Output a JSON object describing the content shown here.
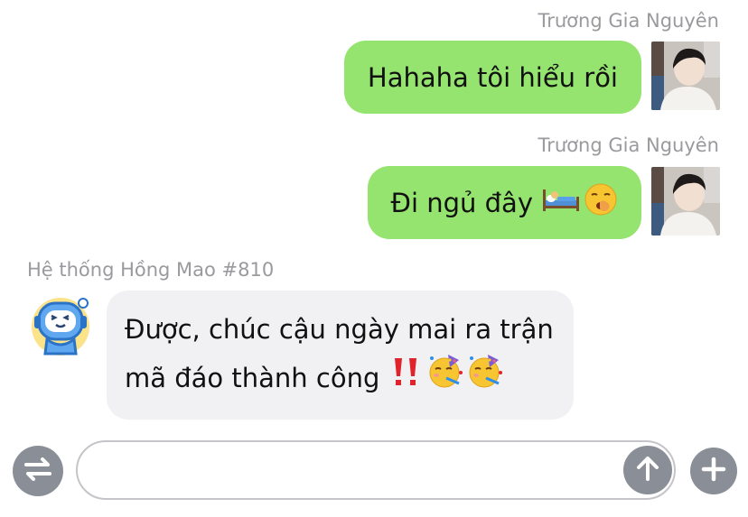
{
  "messages": [
    {
      "sender": "Trương Gia Nguyên",
      "text": "Hahaha tôi hiểu rồi",
      "direction": "outgoing"
    },
    {
      "sender": "Trương Gia Nguyên",
      "text": "Đi ngủ đây",
      "emojis": [
        "bed-emoji",
        "yawning-face-emoji"
      ],
      "direction": "outgoing"
    },
    {
      "sender": "Hệ thống Hồng Mao #810",
      "line1": "Được, chúc cậu ngày mai ra trận",
      "line2": "mã đáo thành công",
      "emojis": [
        "double-exclamation-emoji",
        "partying-face-emoji",
        "partying-face-emoji"
      ],
      "direction": "incoming"
    }
  ],
  "composer": {
    "placeholder": ""
  },
  "colors": {
    "outgoing_bubble": "#95e46f",
    "incoming_bubble": "#f1f1f3",
    "sender_name": "#9a9a9e",
    "round_buttons": "#8a8e96"
  },
  "icons": {
    "left_button": "swap-arrows-icon",
    "send_button": "arrow-up-icon",
    "right_button": "plus-icon"
  }
}
